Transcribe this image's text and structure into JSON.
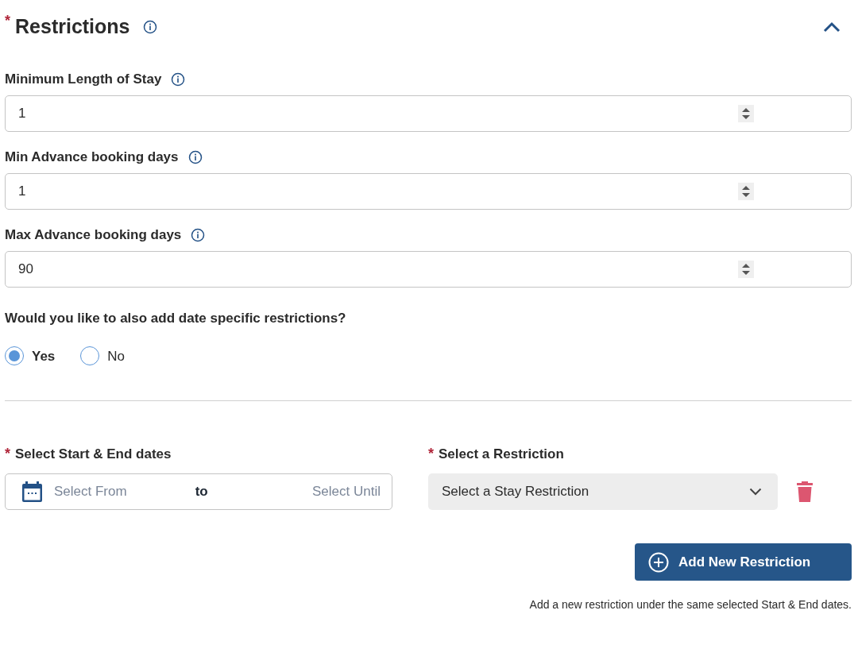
{
  "section": {
    "title": "Restrictions",
    "required_mark": "*",
    "expanded": true
  },
  "number_fields": [
    {
      "label": "Minimum Length of Stay",
      "value": "1"
    },
    {
      "label": "Min Advance booking days",
      "value": "1"
    },
    {
      "label": "Max Advance booking days",
      "value": "90"
    }
  ],
  "date_question": {
    "label": "Would you like to also add date specific restrictions?",
    "options": [
      {
        "label": "Yes",
        "selected": true
      },
      {
        "label": "No",
        "selected": false
      }
    ]
  },
  "date_range": {
    "label": "Select Start & End dates",
    "required_mark": "*",
    "from_placeholder": "Select From",
    "separator": "to",
    "until_placeholder": "Select Until"
  },
  "restriction": {
    "label": "Select a Restriction",
    "required_mark": "*",
    "placeholder": "Select a Stay Restriction"
  },
  "add_button": {
    "label": "Add New Restriction"
  },
  "help_text": "Add a new restriction under the same selected Start & End dates."
}
